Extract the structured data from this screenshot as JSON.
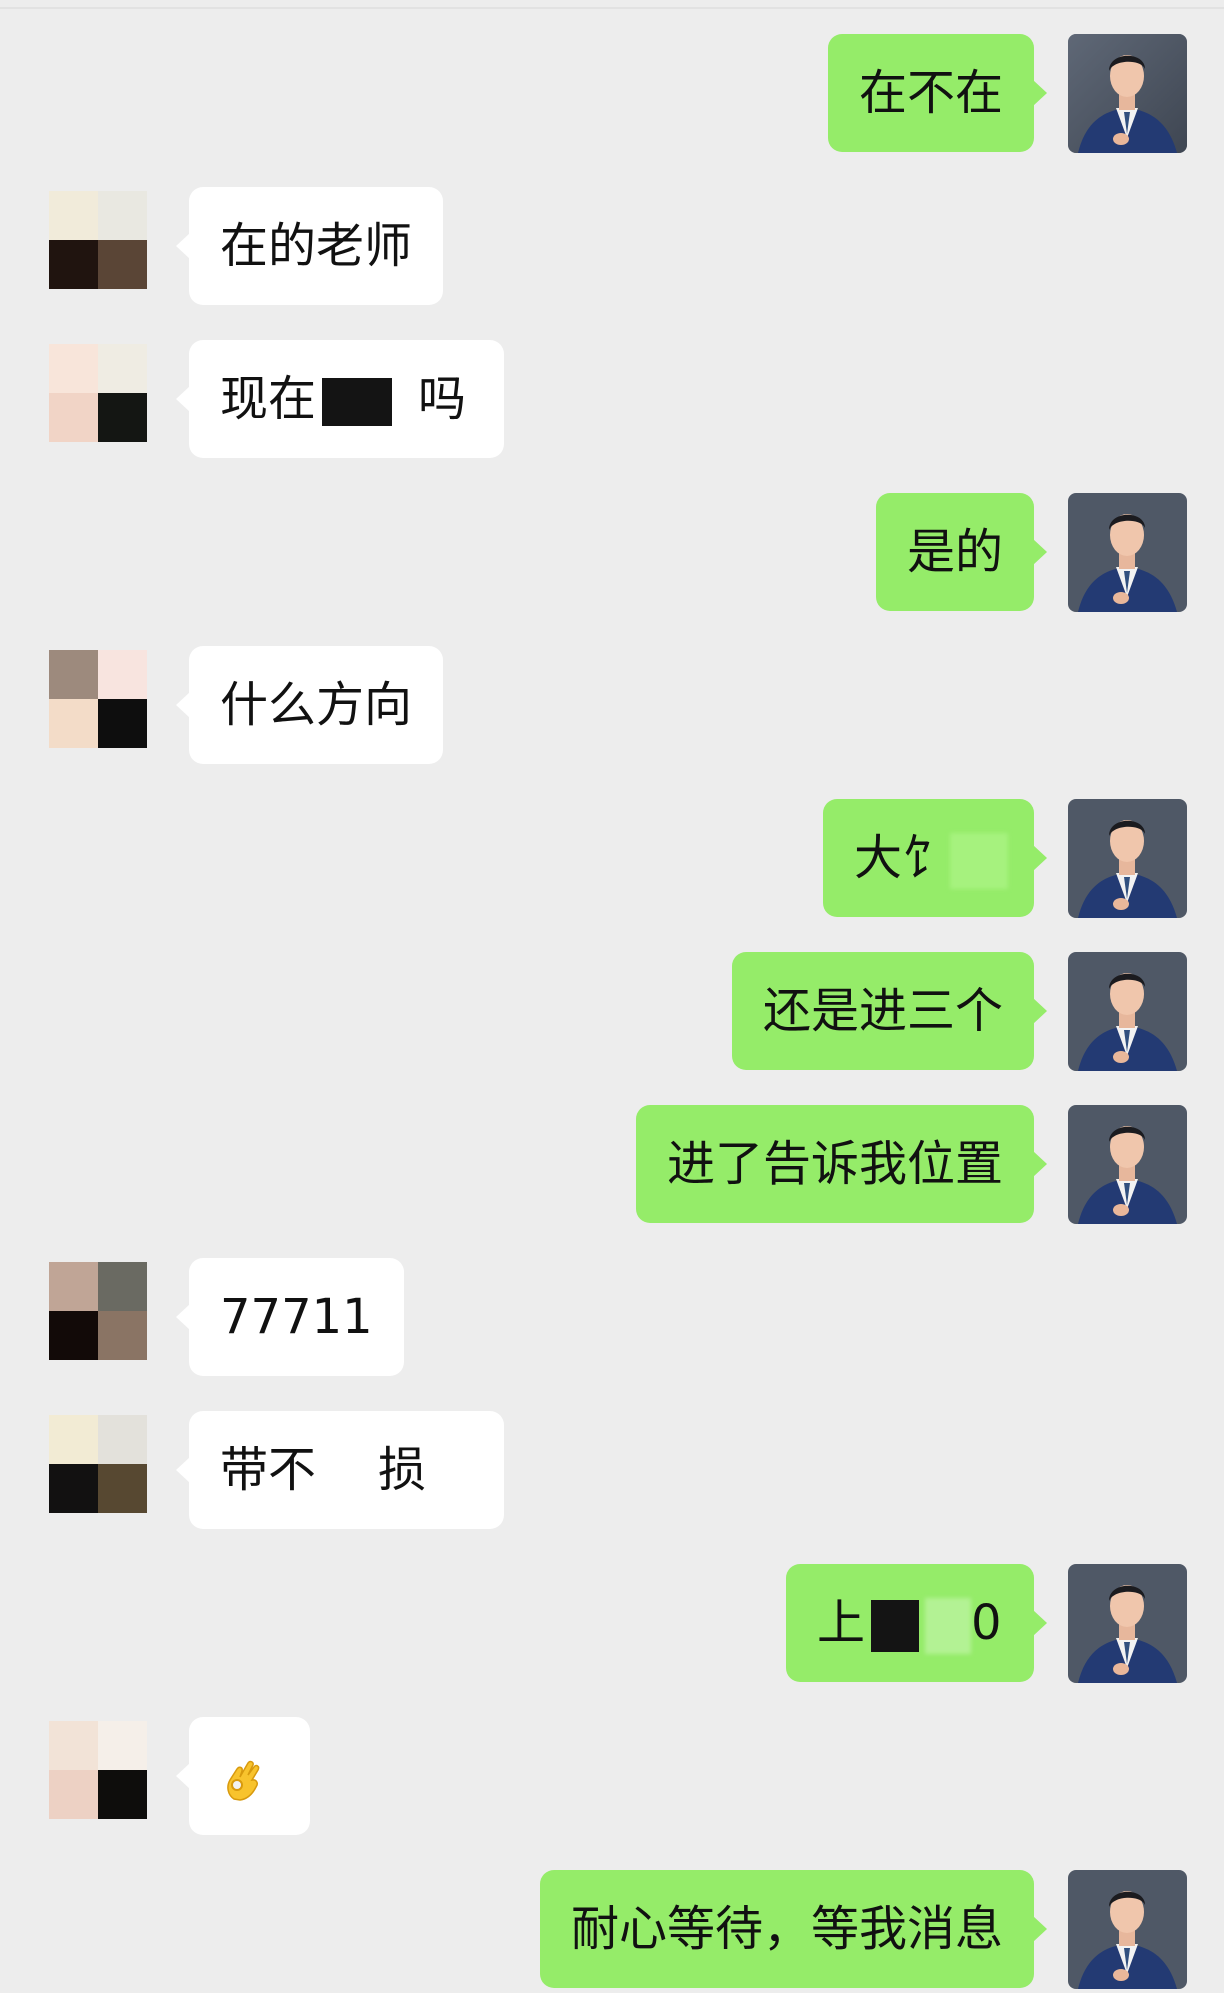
{
  "messages": [
    {
      "side": "right",
      "text": "在不在"
    },
    {
      "side": "left",
      "text": "在的老师"
    },
    {
      "side": "left",
      "text_parts": [
        "现在",
        "吗"
      ],
      "redacted": true
    },
    {
      "side": "right",
      "text": "是的"
    },
    {
      "side": "left",
      "text": "什么方向"
    },
    {
      "side": "right",
      "text_parts": [
        "大饣"
      ],
      "redacted": true
    },
    {
      "side": "right",
      "text": "还是进三个"
    },
    {
      "side": "right",
      "text": "进了告诉我位置"
    },
    {
      "side": "left",
      "text": "77711"
    },
    {
      "side": "left",
      "text_parts": [
        "带不",
        "损"
      ],
      "redacted": true
    },
    {
      "side": "right",
      "text_parts": [
        "上",
        "0"
      ],
      "redacted": true
    },
    {
      "side": "left",
      "emoji": "ok-hand"
    },
    {
      "side": "right",
      "text": "耐心等待，等我消息"
    }
  ],
  "colors": {
    "background": "#EDEDED",
    "own_bubble": "#95EC69",
    "peer_bubble": "#FFFFFF"
  },
  "icons": {
    "own_avatar": "suited-man-avatar-icon",
    "peer_avatar": "pixelated-avatar-icon",
    "emoji": "ok-hand-icon"
  }
}
